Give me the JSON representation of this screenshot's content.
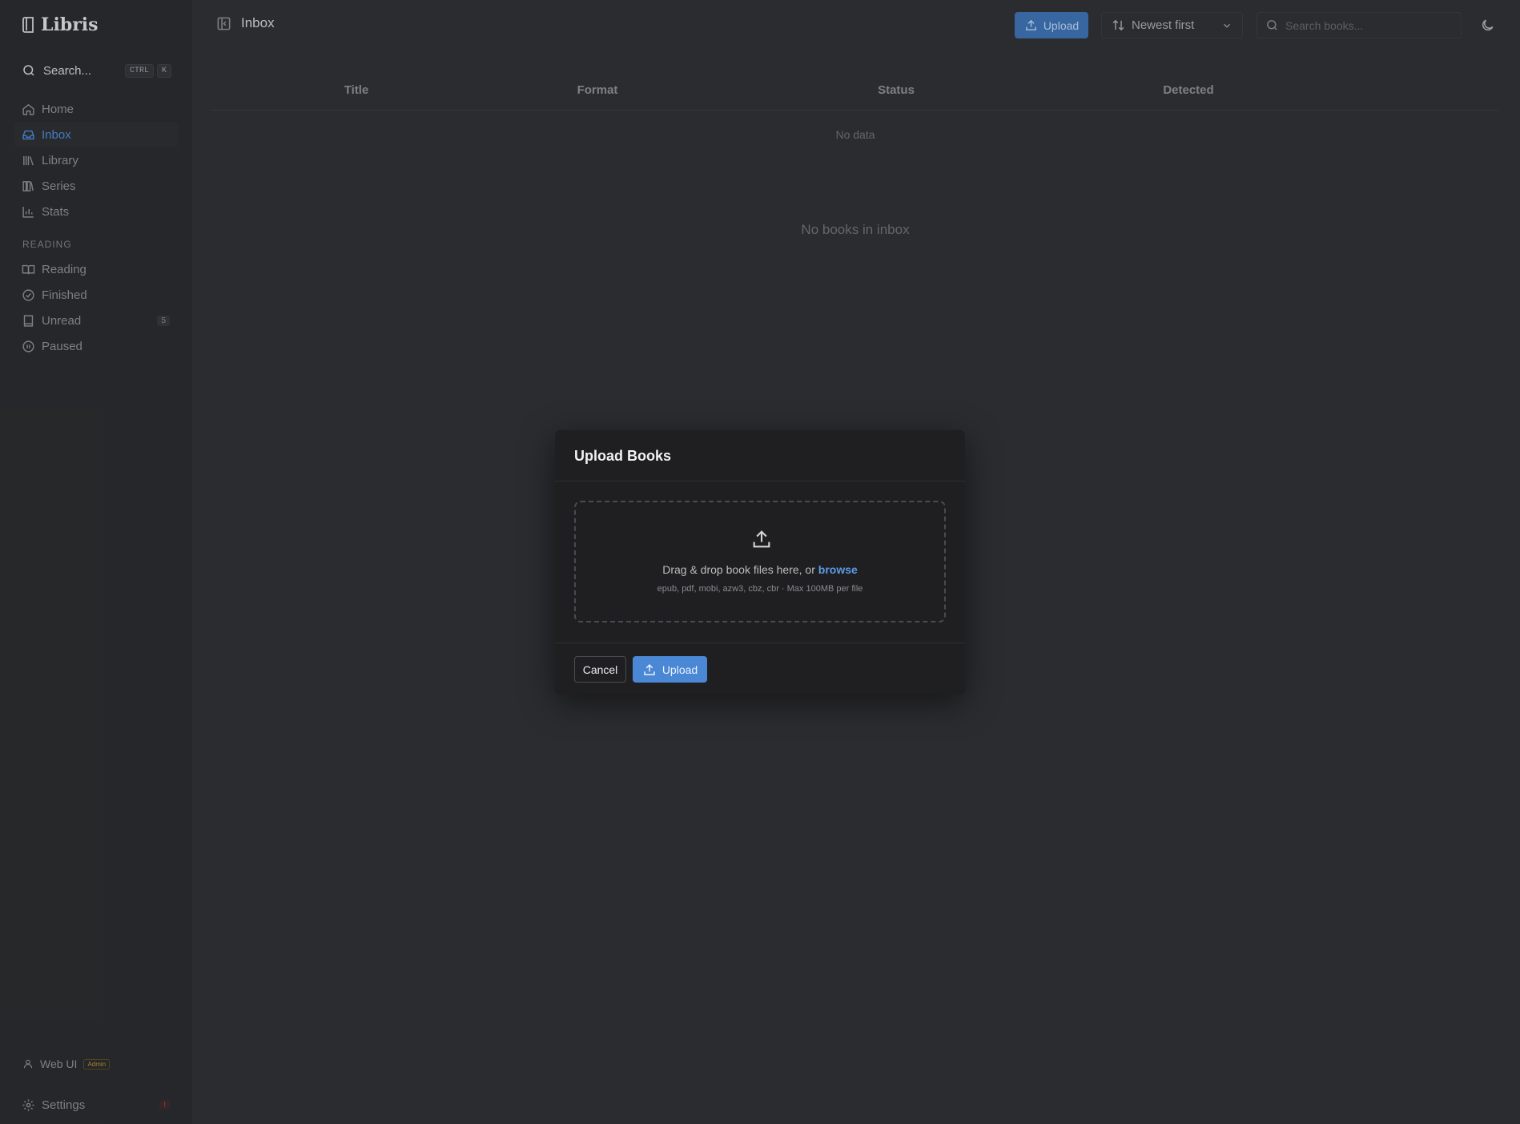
{
  "app": {
    "name": "Libris"
  },
  "sidebar": {
    "search_label": "Search...",
    "shortcut_keys": [
      "CTRL",
      "K"
    ],
    "nav": [
      {
        "label": "Home",
        "icon": "home-icon"
      },
      {
        "label": "Inbox",
        "icon": "inbox-icon",
        "active": true
      },
      {
        "label": "Library",
        "icon": "library-icon"
      },
      {
        "label": "Series",
        "icon": "series-icon"
      },
      {
        "label": "Stats",
        "icon": "stats-icon"
      }
    ],
    "reading_section": "READING",
    "reading": [
      {
        "label": "Reading",
        "icon": "book-open-icon"
      },
      {
        "label": "Finished",
        "icon": "check-circle-icon"
      },
      {
        "label": "Unread",
        "icon": "book-icon",
        "count": "5"
      },
      {
        "label": "Paused",
        "icon": "pause-circle-icon"
      }
    ],
    "user_label": "Web UI",
    "user_role": "Admin",
    "settings_label": "Settings",
    "settings_badge": "!"
  },
  "header": {
    "title": "Inbox",
    "upload_label": "Upload",
    "sort_value": "Newest first",
    "search_placeholder": "Search books..."
  },
  "table": {
    "columns": [
      "Title",
      "Format",
      "Status",
      "Detected"
    ],
    "empty_text": "No data",
    "empty_state": "No books in inbox"
  },
  "dialog": {
    "title": "Upload Books",
    "drop_text": "Drag & drop book files here, or ",
    "browse_label": "browse",
    "hint": "epub, pdf, mobi, azw3, cbz, cbr · Max 100MB per file",
    "cancel_label": "Cancel",
    "upload_label": "Upload"
  },
  "colors": {
    "accent": "#4a87d4",
    "background": "#2f3033",
    "dialog": "#1f1f21"
  }
}
